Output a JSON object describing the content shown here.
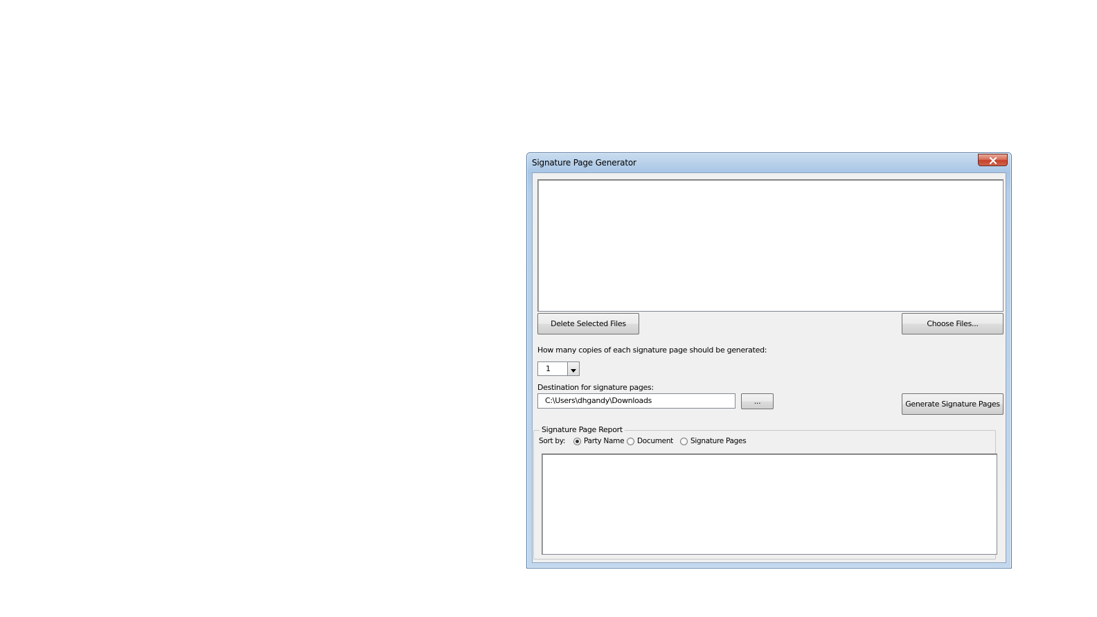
{
  "window": {
    "title": "Signature Page Generator"
  },
  "icons": {
    "close": "close-icon",
    "dropdown": "chevron-down-icon"
  },
  "files": {
    "items": [],
    "delete_label": "Delete Selected Files",
    "choose_label": "Choose Files..."
  },
  "copies": {
    "label": "How many copies of each signature page should be generated:",
    "selected": "1"
  },
  "destination": {
    "label": "Destination for signature pages:",
    "value": "C:\\Users\\dhgandy\\Downloads",
    "browse_label": "...",
    "generate_label": "Generate Signature Pages"
  },
  "report": {
    "title": "Signature Page Report",
    "sort_label": "Sort by:",
    "sort_options": [
      "Party Name",
      "Document",
      "Signature Pages"
    ],
    "selected_sort": "Party Name",
    "content": ""
  },
  "colors": {
    "close_button": "#c4402a",
    "title_bar": "#b9d1ea",
    "client_background": "#f0f0f0"
  }
}
